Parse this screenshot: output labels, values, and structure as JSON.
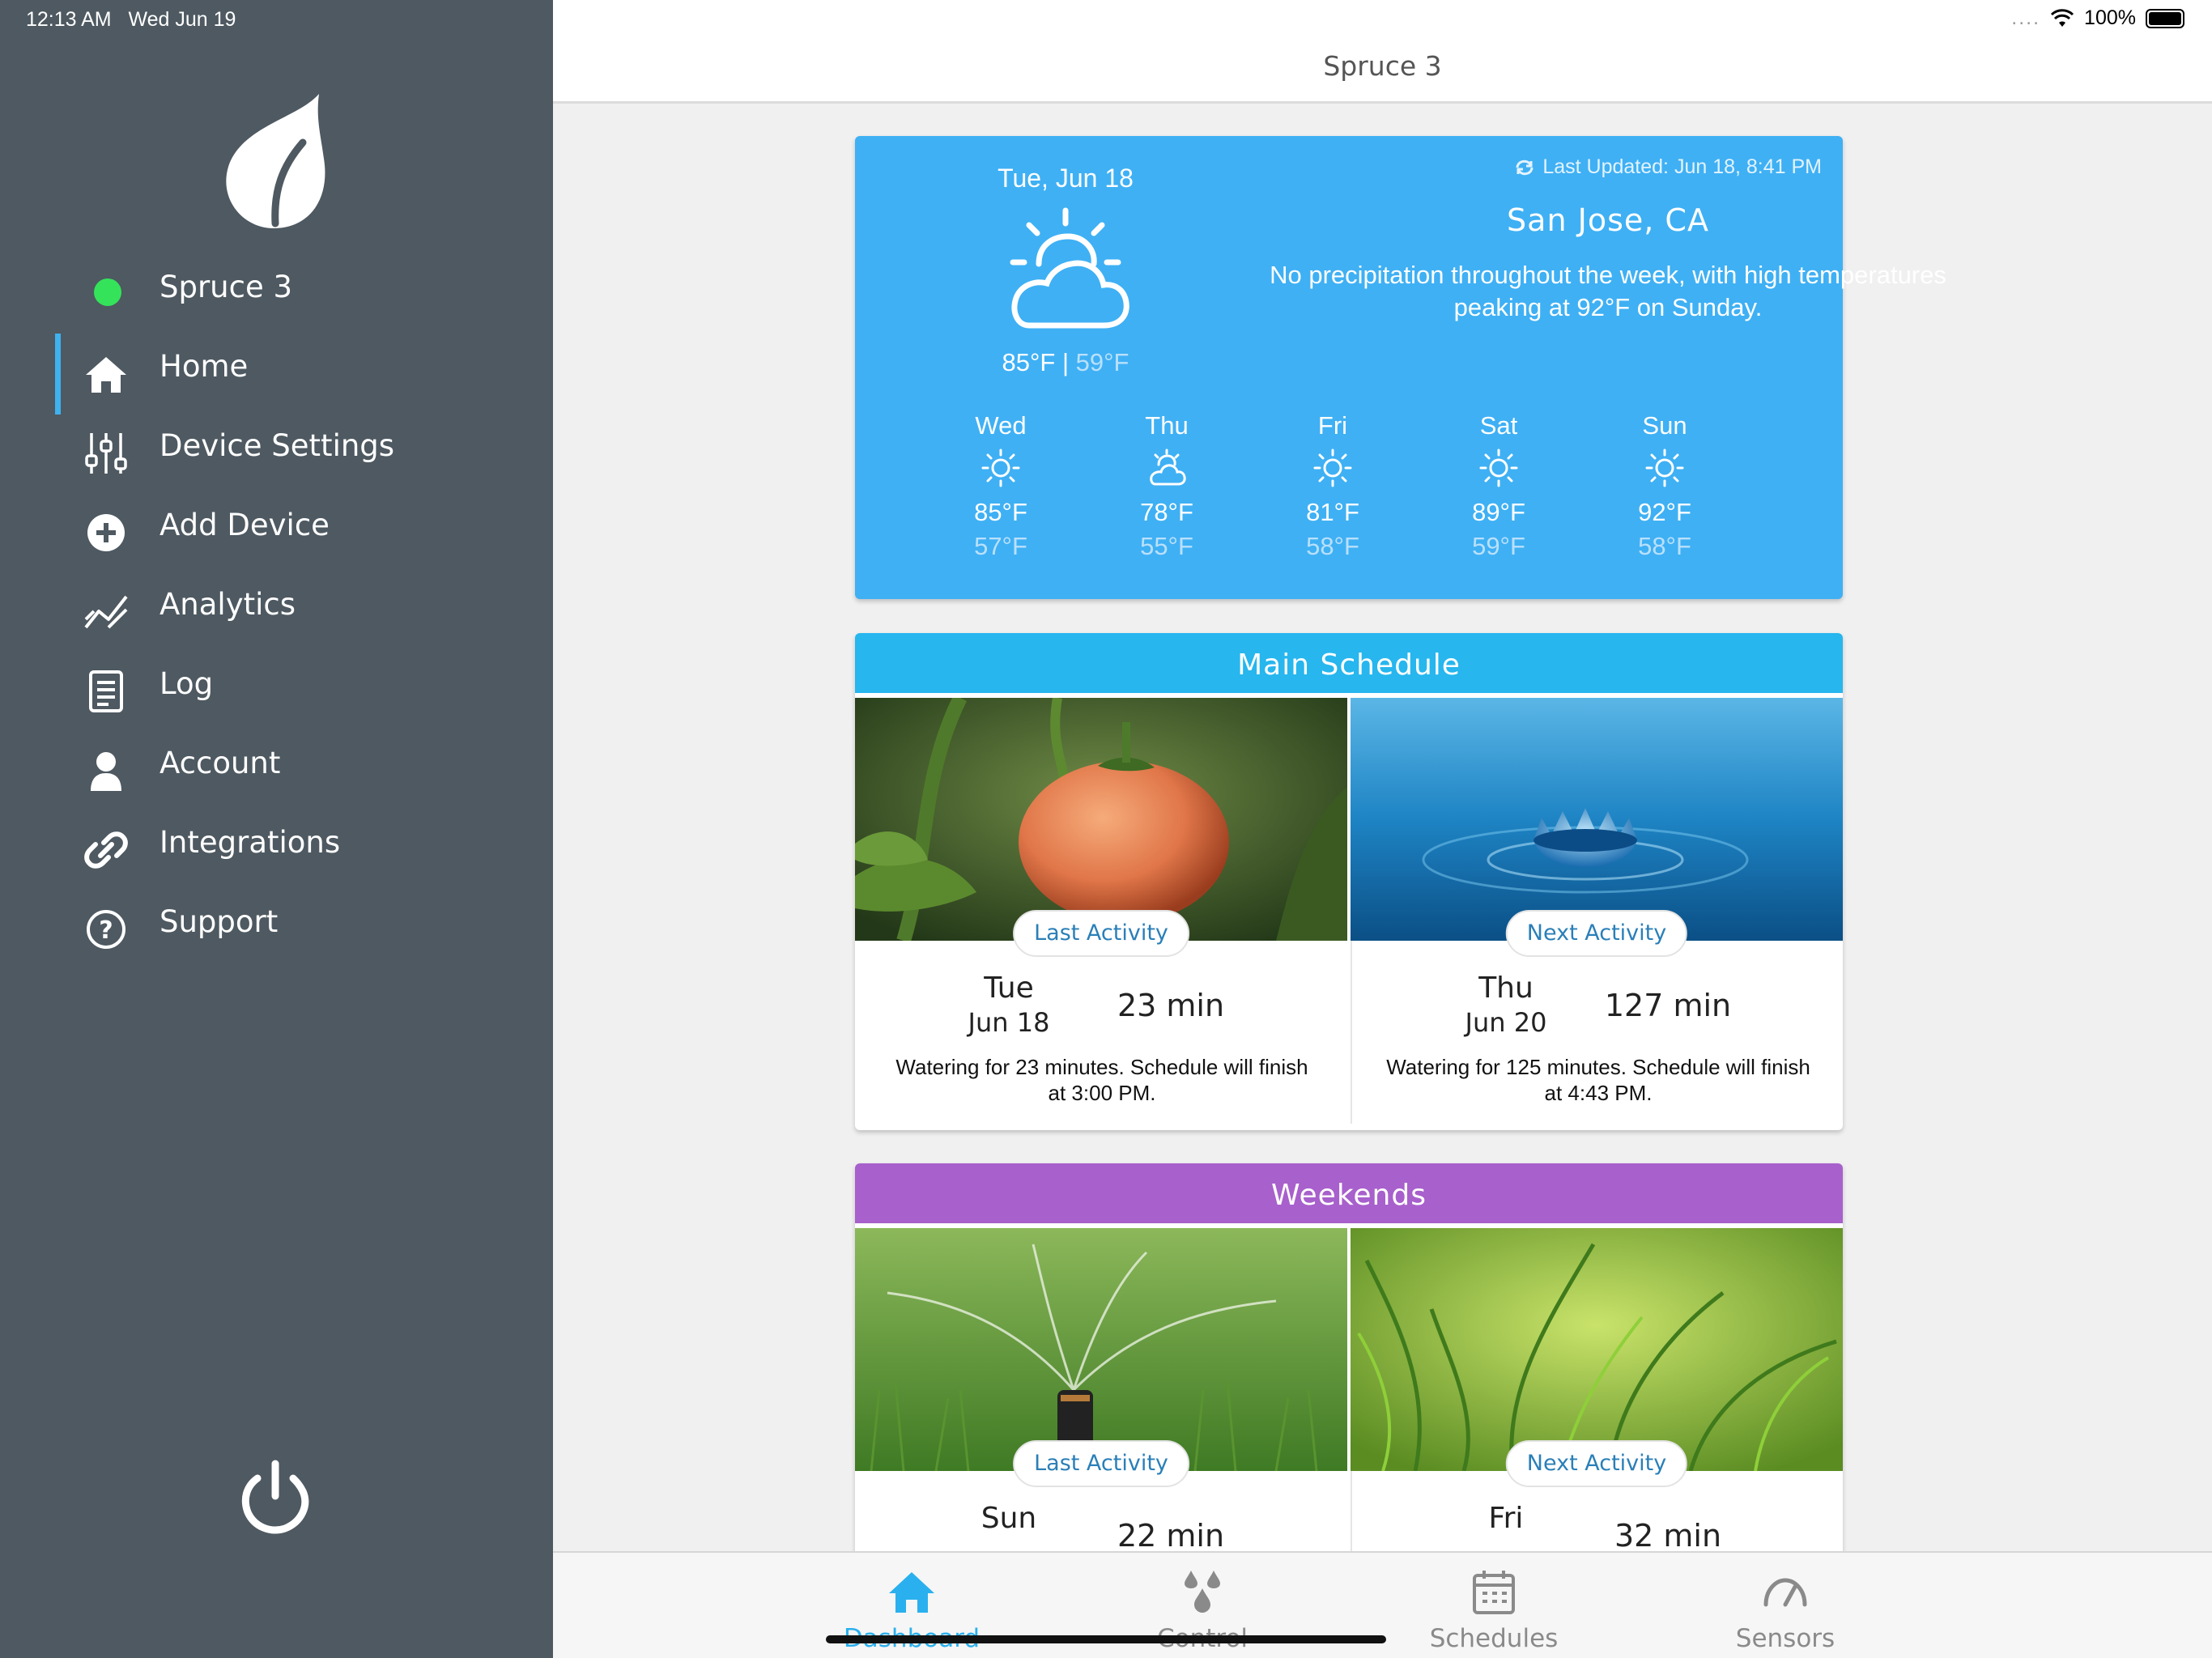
{
  "status_bar": {
    "time": "12:13 AM",
    "date": "Wed Jun 19",
    "battery": "100%"
  },
  "sidebar": {
    "device": {
      "name": "Spruce 3",
      "status_color": "#34e35a"
    },
    "items": [
      {
        "label": "Home",
        "icon": "home-icon",
        "active": true
      },
      {
        "label": "Device Settings",
        "icon": "sliders-icon"
      },
      {
        "label": "Add Device",
        "icon": "plus-circle-icon"
      },
      {
        "label": "Analytics",
        "icon": "chart-line-icon"
      },
      {
        "label": "Log",
        "icon": "document-icon"
      },
      {
        "label": "Account",
        "icon": "user-icon"
      },
      {
        "label": "Integrations",
        "icon": "link-icon"
      },
      {
        "label": "Support",
        "icon": "question-circle-icon"
      }
    ]
  },
  "header": {
    "title": "Spruce 3"
  },
  "weather": {
    "date": "Tue, Jun 18",
    "high": "85°F",
    "separator": "|",
    "low": "59°F",
    "updated": "Last Updated: Jun 18, 8:41 PM",
    "city": "San Jose, CA",
    "description": "No precipitation throughout the week, with high temperatures peaking at 92°F on Sunday.",
    "forecast": [
      {
        "day": "Wed",
        "icon": "sun-icon",
        "high": "85°F",
        "low": "57°F"
      },
      {
        "day": "Thu",
        "icon": "partly-cloudy-icon",
        "high": "78°F",
        "low": "55°F"
      },
      {
        "day": "Fri",
        "icon": "sun-icon",
        "high": "81°F",
        "low": "58°F"
      },
      {
        "day": "Sat",
        "icon": "sun-icon",
        "high": "89°F",
        "low": "59°F"
      },
      {
        "day": "Sun",
        "icon": "sun-icon",
        "high": "92°F",
        "low": "58°F"
      }
    ]
  },
  "schedules": [
    {
      "name": "Main Schedule",
      "color": "#27b6ee",
      "last": {
        "label": "Last Activity",
        "day": "Tue",
        "date": "Jun 18",
        "minutes": "23 min",
        "note": "Watering for 23 minutes. Schedule will finish at 3:00 PM."
      },
      "next": {
        "label": "Next Activity",
        "day": "Thu",
        "date": "Jun 20",
        "minutes": "127 min",
        "note": "Watering for 125 minutes. Schedule will finish at 4:43 PM."
      }
    },
    {
      "name": "Weekends",
      "color": "#a860cc",
      "last": {
        "label": "Last Activity",
        "day": "Sun",
        "minutes": "22 min"
      },
      "next": {
        "label": "Next Activity",
        "day": "Fri",
        "minutes": "32 min"
      }
    }
  ],
  "tabs": [
    {
      "label": "Dashboard",
      "icon": "home-icon",
      "active": true
    },
    {
      "label": "Control",
      "icon": "water-drops-icon"
    },
    {
      "label": "Schedules",
      "icon": "calendar-icon"
    },
    {
      "label": "Sensors",
      "icon": "gauge-icon"
    }
  ],
  "colors": {
    "sidebar": "#4e5961",
    "accent": "#2ab0ee",
    "weather_card": "#3fb0f4"
  }
}
